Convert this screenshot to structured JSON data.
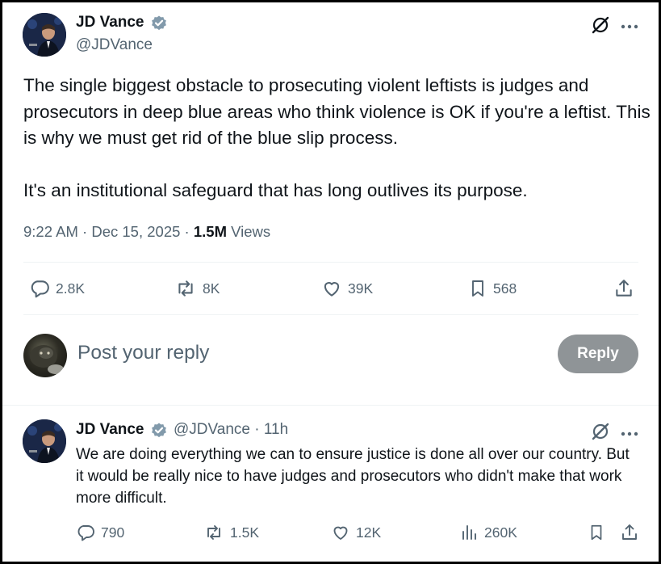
{
  "main_tweet": {
    "author_name": "JD Vance",
    "author_handle": "@JDVance",
    "text_lines": [
      "The single biggest obstacle to prosecuting violent leftists is judges and prosecutors in deep blue areas who think violence is OK if you're a leftist. This is why we must get rid of the blue slip process.",
      "It's an institutional safeguard that has long outlives its purpose."
    ],
    "time": "9:22 AM",
    "date": "Dec 15, 2025",
    "separator": "·",
    "views_count": "1.5M",
    "views_label": "Views",
    "stats": {
      "replies": "2.8K",
      "reposts": "8K",
      "likes": "39K",
      "bookmarks": "568"
    }
  },
  "reply_composer": {
    "placeholder": "Post your reply",
    "button_label": "Reply"
  },
  "reply_tweet": {
    "author_name": "JD Vance",
    "author_handle": "@JDVance",
    "separator": "·",
    "age": "11h",
    "text": "We are doing everything we can to ensure justice is done all over our country. But it would be really nice to have judges and prosecutors who didn't make that work more difficult.",
    "stats": {
      "replies": "790",
      "reposts": "1.5K",
      "likes": "12K",
      "views": "260K"
    }
  },
  "icons": {
    "verified": "verified-badge-icon",
    "grok": "grok-icon",
    "more": "more-icon",
    "reply": "reply-icon",
    "repost": "repost-icon",
    "like": "like-icon",
    "bookmark": "bookmark-icon",
    "share": "share-icon",
    "views": "views-icon"
  },
  "colors": {
    "text_primary": "#0f1419",
    "text_secondary": "#536471",
    "verified_badge": "#829aab",
    "reply_button_disabled": "#8f9497",
    "divider": "#eff3f4"
  }
}
